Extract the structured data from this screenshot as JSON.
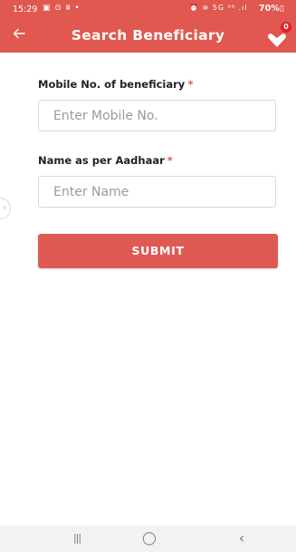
{
  "status_bar": {
    "time": "15:29",
    "left_icons": "▣ ⊙ ⩩ •",
    "right_icons": "⏰ ≋ 5G ⁸⁸ .ıl",
    "battery": "70%▯"
  },
  "app_bar": {
    "title": "Search Beneficiary",
    "back_icon": "arrow-left",
    "filter_icon": "heart-down",
    "filter_count": "0",
    "background": "#e0584f"
  },
  "form": {
    "mobile": {
      "label": "Mobile No. of beneficiary",
      "required_mark": "*",
      "placeholder": "Enter Mobile No.",
      "value": ""
    },
    "name": {
      "label": "Name as per Aadhaar",
      "required_mark": "*",
      "placeholder": "Enter Name",
      "value": ""
    },
    "submit_label": "SUBMIT",
    "button_color": "#df5a52"
  },
  "side_tab": {
    "icon": "chevron-right",
    "glyph": "›"
  },
  "nav_bar": {
    "recents": "|||",
    "home": "◯",
    "back": "‹"
  }
}
